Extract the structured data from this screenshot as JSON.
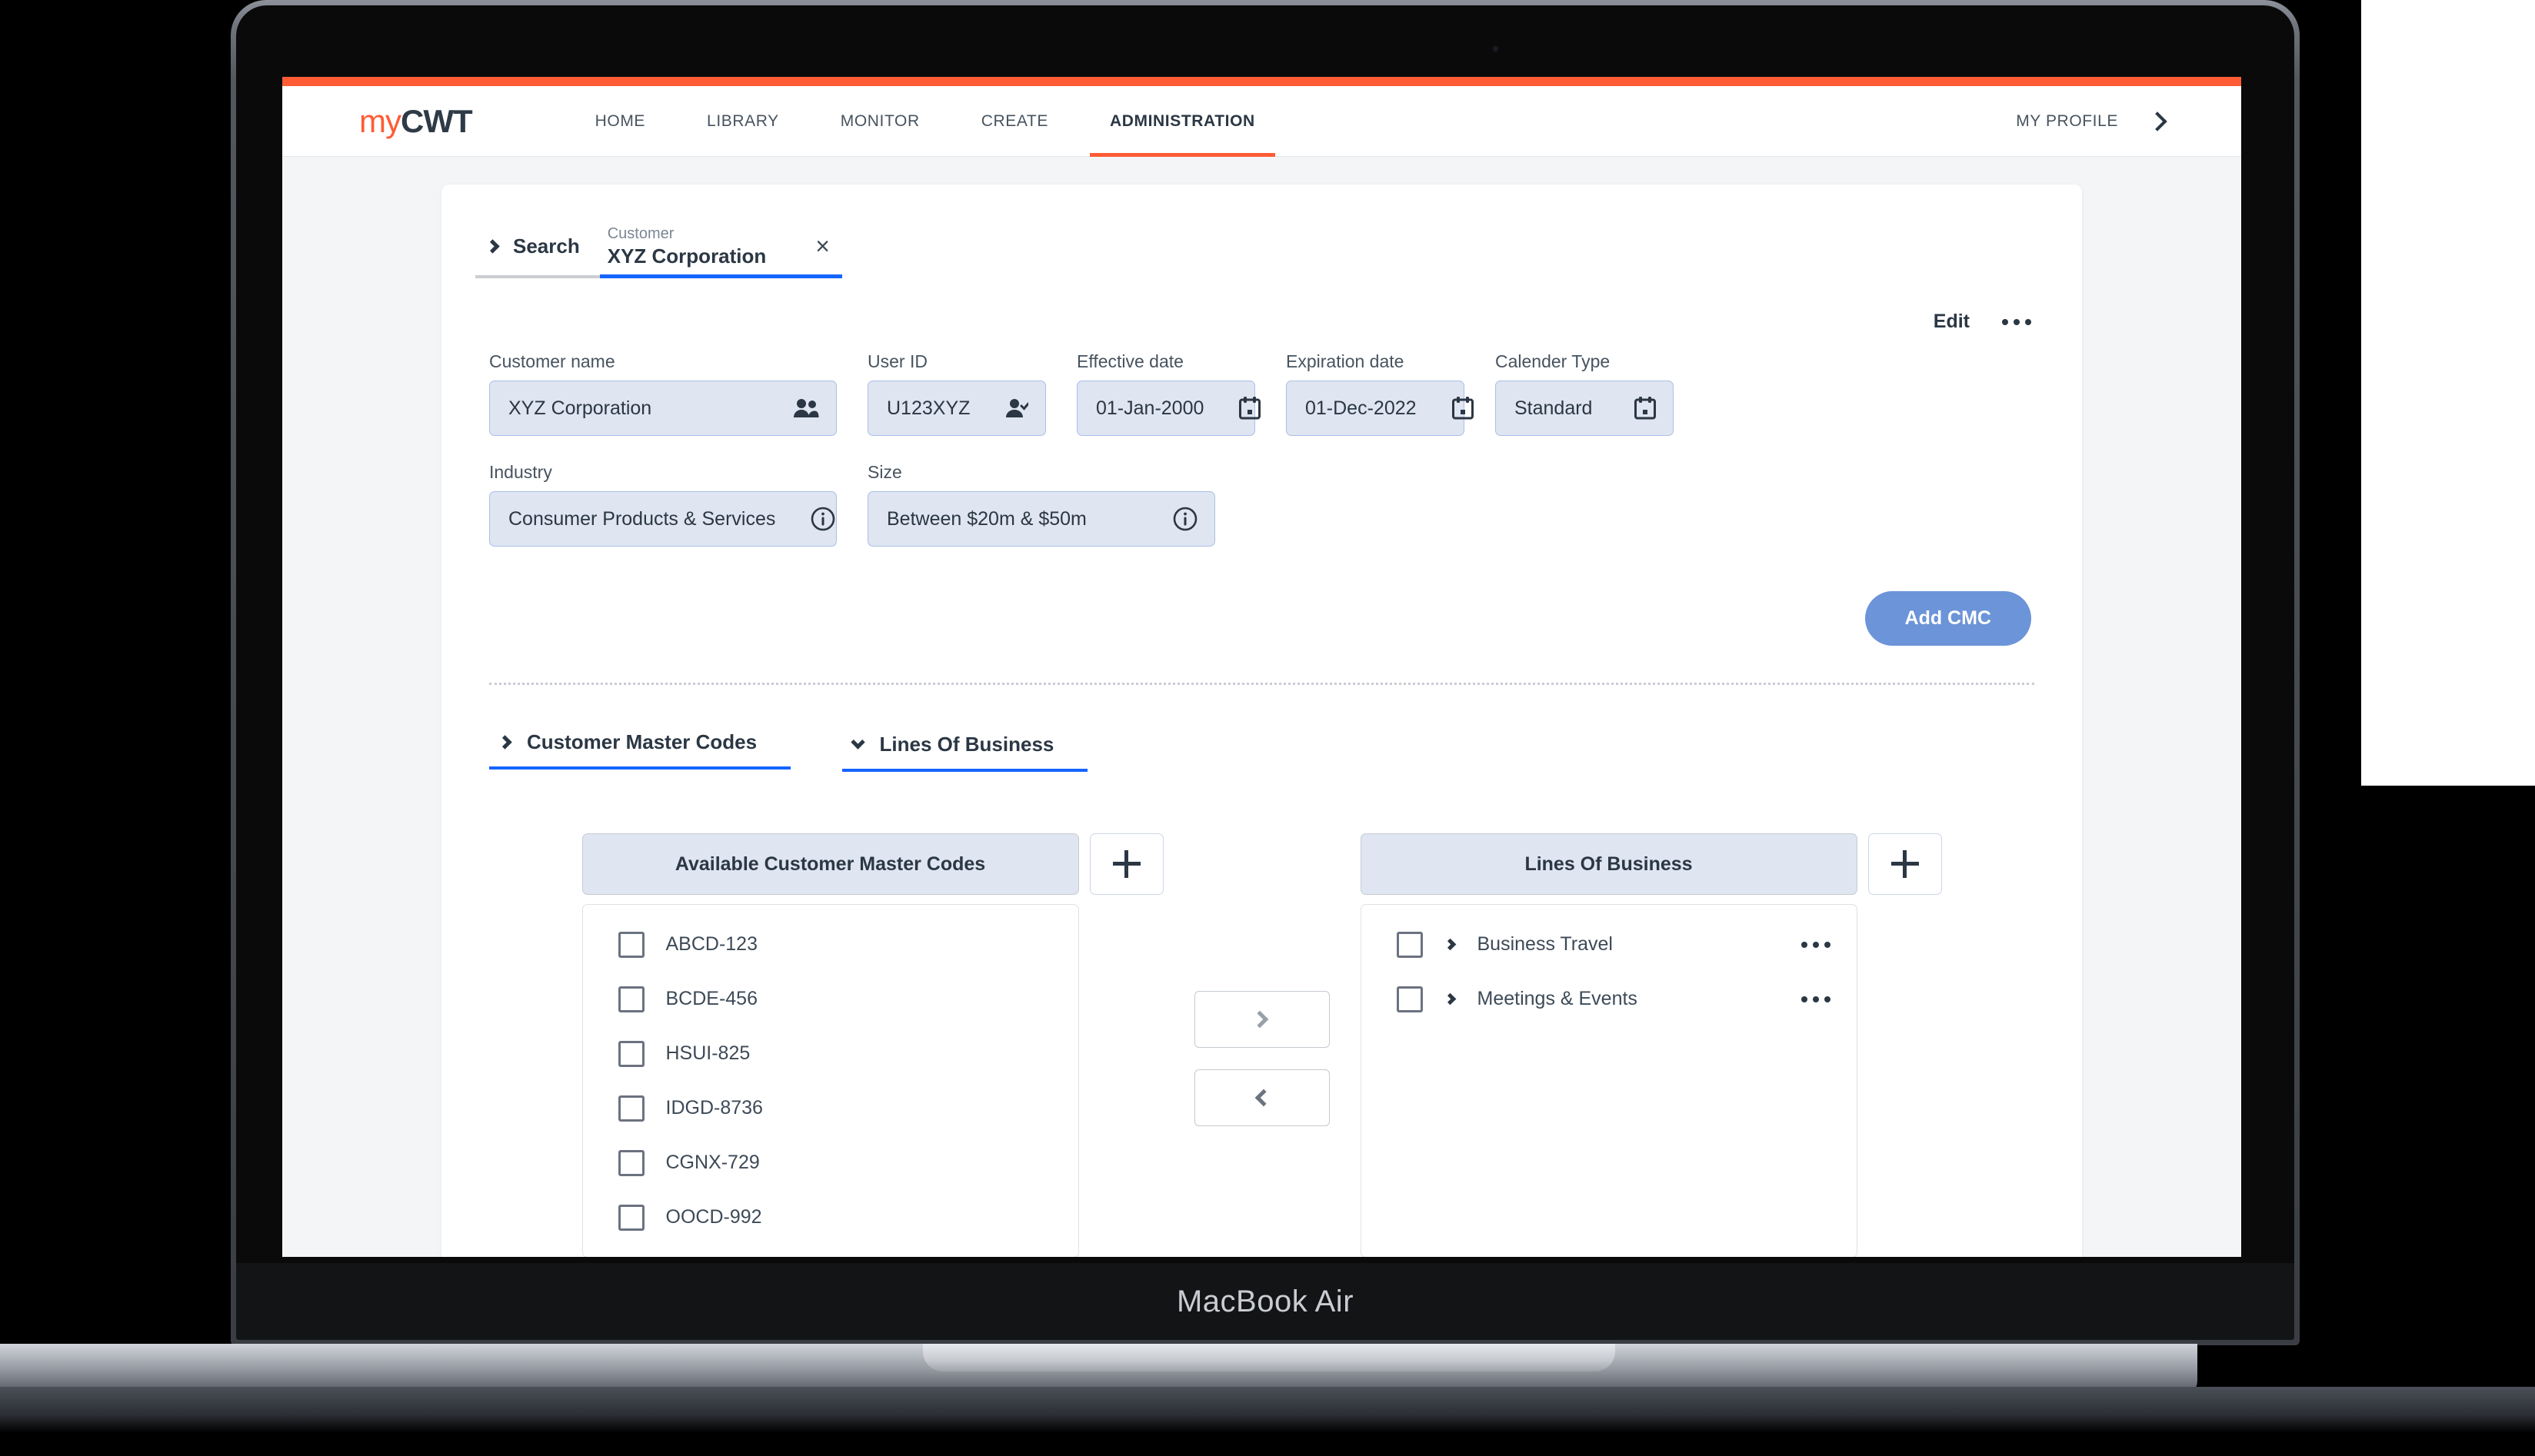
{
  "device": {
    "model_name": "MacBook Air"
  },
  "brand": {
    "prefix": "my",
    "suffix": "CWT"
  },
  "topnav": {
    "items": [
      {
        "label": "HOME",
        "active": false
      },
      {
        "label": "LIBRARY",
        "active": false
      },
      {
        "label": "MONITOR",
        "active": false
      },
      {
        "label": "CREATE",
        "active": false
      },
      {
        "label": "ADMINISTRATION",
        "active": true
      }
    ],
    "profile_label": "MY PROFILE",
    "profile_chevron_icon": "chevron-right-icon",
    "active_underline_color": "#ff5c35",
    "top_bar_color": "#ff5c35"
  },
  "tabs": {
    "search": {
      "label": "Search",
      "chevron_icon": "chevron-right-icon"
    },
    "customer": {
      "kicker": "Customer",
      "label": "XYZ Corporation",
      "close_icon": "close-icon",
      "close_glyph": "×",
      "active_underline_color": "#1565ff"
    }
  },
  "actions": {
    "edit_label": "Edit",
    "kebab_icon": "more-options-icon",
    "add_cmc_label": "Add CMC",
    "add_cmc_color": "#6c94d8"
  },
  "form": {
    "fields": [
      {
        "label": "Customer name",
        "value": "XYZ Corporation",
        "icon": "people-icon",
        "width_class": "w-customer"
      },
      {
        "label": "User ID",
        "value": "U123XYZ",
        "icon": "user-check-icon",
        "width_class": "w-userid"
      },
      {
        "label": "Effective date",
        "value": "01-Jan-2000",
        "icon": "calendar-icon",
        "width_class": "w-date"
      },
      {
        "label": "Expiration date",
        "value": "01-Dec-2022",
        "icon": "calendar-icon",
        "width_class": "w-date"
      },
      {
        "label": "Calender Type",
        "value": "Standard",
        "icon": "calendar-icon",
        "width_class": "w-cal"
      },
      {
        "label": "Industry",
        "value": "Consumer Products & Services",
        "icon": "info-icon",
        "width_class": "w-industry"
      },
      {
        "label": "Size",
        "value": "Between $20m & $50m",
        "icon": "info-icon",
        "width_class": "w-size"
      }
    ],
    "field_bg": "#dfe5f1",
    "field_border": "#a9c0e8"
  },
  "sections": [
    {
      "title": "Customer Master Codes",
      "expanded": false,
      "chevron_icon": "chevron-right-icon"
    },
    {
      "title": "Lines Of Business",
      "expanded": true,
      "chevron_icon": "chevron-down-icon"
    }
  ],
  "dual_list": {
    "left": {
      "title": "Available Customer Master Codes",
      "add_icon": "plus-icon",
      "items": [
        {
          "label": "ABCD-123",
          "checked": false
        },
        {
          "label": "BCDE-456",
          "checked": false
        },
        {
          "label": "HSUI-825",
          "checked": false
        },
        {
          "label": "IDGD-8736",
          "checked": false
        },
        {
          "label": "CGNX-729",
          "checked": false
        },
        {
          "label": "OOCD-992",
          "checked": false
        }
      ]
    },
    "right": {
      "title": "Lines Of Business",
      "add_icon": "plus-icon",
      "items": [
        {
          "label": "Business Travel",
          "checked": false,
          "chevron_icon": "chevron-right-icon",
          "kebab_icon": "more-options-icon"
        },
        {
          "label": "Meetings & Events",
          "checked": false,
          "chevron_icon": "chevron-right-icon",
          "kebab_icon": "more-options-icon"
        }
      ]
    },
    "transfer": {
      "move_right_icon": "chevron-right-icon",
      "move_left_icon": "chevron-left-icon"
    }
  }
}
